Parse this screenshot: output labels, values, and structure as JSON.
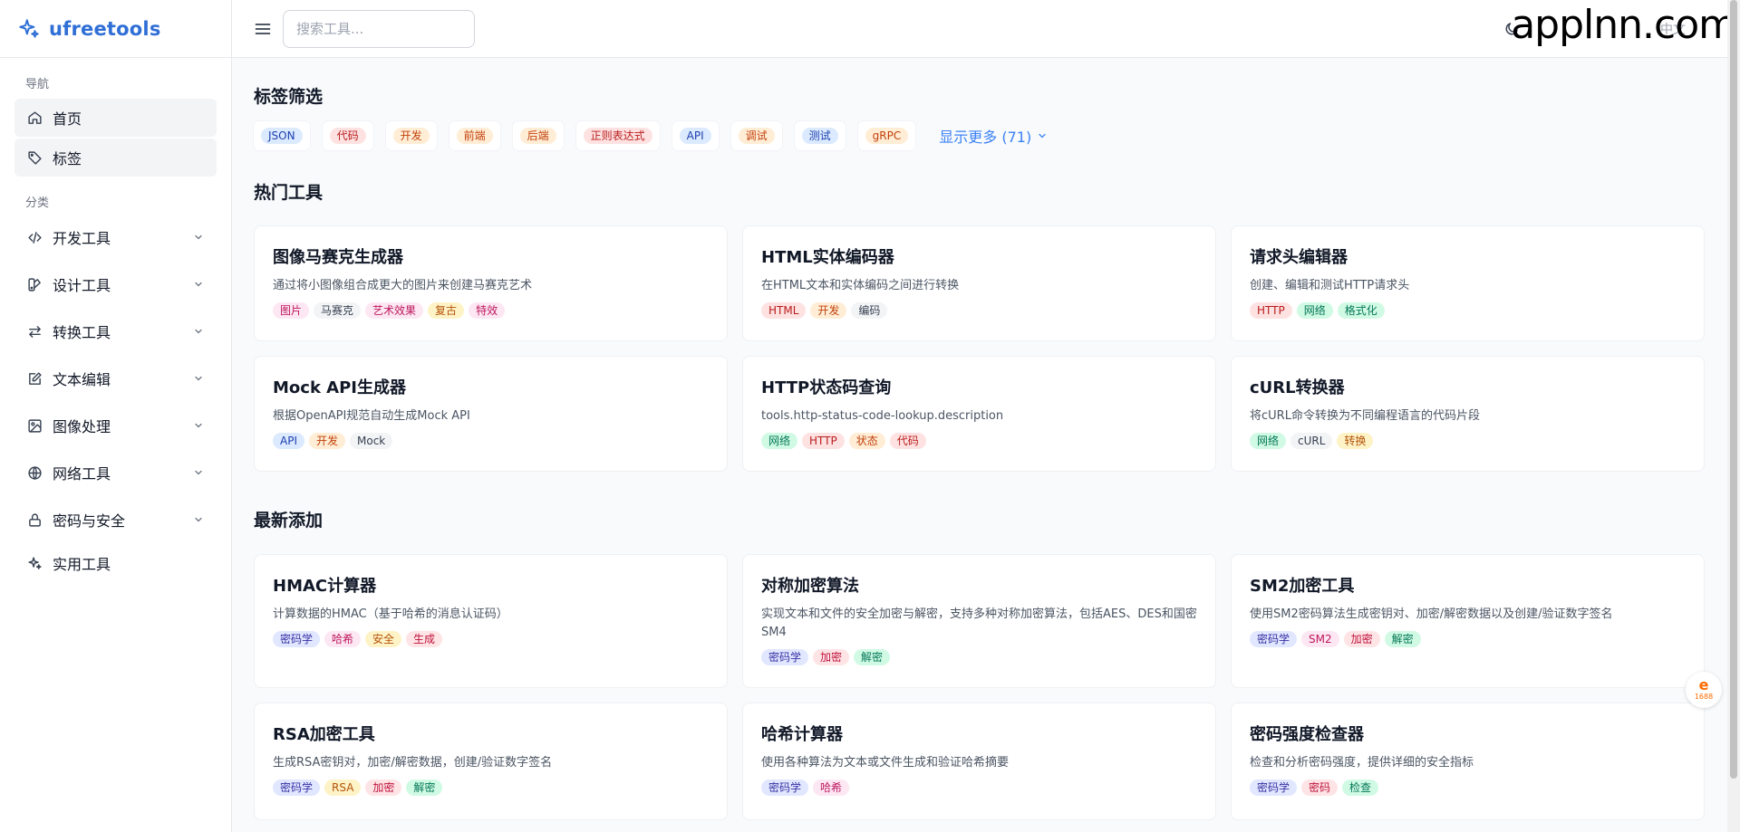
{
  "brand": {
    "name": "ufreetools"
  },
  "sidebar": {
    "nav_label": "导航",
    "nav_items": [
      {
        "label": "首页",
        "icon": "home-icon"
      },
      {
        "label": "标签",
        "icon": "tag-icon"
      }
    ],
    "category_label": "分类",
    "categories": [
      {
        "label": "开发工具",
        "icon": "code-icon"
      },
      {
        "label": "设计工具",
        "icon": "palette-icon"
      },
      {
        "label": "转换工具",
        "icon": "arrows-icon"
      },
      {
        "label": "文本编辑",
        "icon": "edit-icon"
      },
      {
        "label": "图像处理",
        "icon": "image-icon"
      },
      {
        "label": "网络工具",
        "icon": "globe-icon"
      },
      {
        "label": "密码与安全",
        "icon": "lock-icon"
      },
      {
        "label": "实用工具",
        "icon": "sparkle-icon"
      }
    ]
  },
  "header": {
    "search_placeholder": "搜索工具...",
    "faint_text": "中文",
    "watermark": "applnn.com"
  },
  "tag_filter": {
    "title": "标签筛选",
    "tags": [
      {
        "label": "JSON",
        "color": "blue"
      },
      {
        "label": "代码",
        "color": "red"
      },
      {
        "label": "开发",
        "color": "orange"
      },
      {
        "label": "前端",
        "color": "orange"
      },
      {
        "label": "后端",
        "color": "orange"
      },
      {
        "label": "正则表达式",
        "color": "red"
      },
      {
        "label": "API",
        "color": "blue"
      },
      {
        "label": "调试",
        "color": "orange"
      },
      {
        "label": "测试",
        "color": "blue"
      },
      {
        "label": "gRPC",
        "color": "orange"
      }
    ],
    "show_more": "显示更多 (71)"
  },
  "popular": {
    "title": "热门工具",
    "tools": [
      {
        "name": "图像马赛克生成器",
        "desc": "通过将小图像组合成更大的图片来创建马赛克艺术",
        "tags": [
          [
            "图片",
            "pink"
          ],
          [
            "马赛克",
            "gray"
          ],
          [
            "艺术效果",
            "pink"
          ],
          [
            "复古",
            "yellow"
          ],
          [
            "特效",
            "pink"
          ]
        ]
      },
      {
        "name": "HTML实体编码器",
        "desc": "在HTML文本和实体编码之间进行转换",
        "tags": [
          [
            "HTML",
            "red"
          ],
          [
            "开发",
            "orange"
          ],
          [
            "编码",
            "gray"
          ]
        ]
      },
      {
        "name": "请求头编辑器",
        "desc": "创建、编辑和测试HTTP请求头",
        "tags": [
          [
            "HTTP",
            "red"
          ],
          [
            "网络",
            "green"
          ],
          [
            "格式化",
            "green"
          ]
        ]
      },
      {
        "name": "Mock API生成器",
        "desc": "根据OpenAPI规范自动生成Mock API",
        "tags": [
          [
            "API",
            "blue"
          ],
          [
            "开发",
            "orange"
          ],
          [
            "Mock",
            "gray"
          ]
        ]
      },
      {
        "name": "HTTP状态码查询",
        "desc": "tools.http-status-code-lookup.description",
        "tags": [
          [
            "网络",
            "green"
          ],
          [
            "HTTP",
            "red"
          ],
          [
            "状态",
            "orange"
          ],
          [
            "代码",
            "red"
          ]
        ]
      },
      {
        "name": "cURL转换器",
        "desc": "将cURL命令转换为不同编程语言的代码片段",
        "tags": [
          [
            "网络",
            "green"
          ],
          [
            "cURL",
            "gray"
          ],
          [
            "转换",
            "yellow"
          ]
        ]
      }
    ]
  },
  "latest": {
    "title": "最新添加",
    "tools": [
      {
        "name": "HMAC计算器",
        "desc": "计算数据的HMAC（基于哈希的消息认证码）",
        "tags": [
          [
            "密码学",
            "indigo"
          ],
          [
            "哈希",
            "pink"
          ],
          [
            "安全",
            "yellow"
          ],
          [
            "生成",
            "rose"
          ]
        ]
      },
      {
        "name": "对称加密算法",
        "desc": "实现文本和文件的安全加密与解密，支持多种对称加密算法，包括AES、DES和国密SM4",
        "tags": [
          [
            "密码学",
            "indigo"
          ],
          [
            "加密",
            "rose"
          ],
          [
            "解密",
            "green"
          ]
        ]
      },
      {
        "name": "SM2加密工具",
        "desc": "使用SM2密码算法生成密钥对、加密/解密数据以及创建/验证数字签名",
        "tags": [
          [
            "密码学",
            "indigo"
          ],
          [
            "SM2",
            "pink"
          ],
          [
            "加密",
            "rose"
          ],
          [
            "解密",
            "green"
          ]
        ]
      },
      {
        "name": "RSA加密工具",
        "desc": "生成RSA密钥对，加密/解密数据，创建/验证数字签名",
        "tags": [
          [
            "密码学",
            "indigo"
          ],
          [
            "RSA",
            "yellow"
          ],
          [
            "加密",
            "rose"
          ],
          [
            "解密",
            "green"
          ]
        ]
      },
      {
        "name": "哈希计算器",
        "desc": "使用各种算法为文本或文件生成和验证哈希摘要",
        "tags": [
          [
            "密码学",
            "indigo"
          ],
          [
            "哈希",
            "pink"
          ]
        ]
      },
      {
        "name": "密码强度检查器",
        "desc": "检查和分析密码强度，提供详细的安全指标",
        "tags": [
          [
            "密码学",
            "indigo"
          ],
          [
            "密码",
            "rose"
          ],
          [
            "检查",
            "green"
          ]
        ]
      }
    ]
  },
  "float_badge": {
    "line1": "e",
    "line2": "1688"
  }
}
